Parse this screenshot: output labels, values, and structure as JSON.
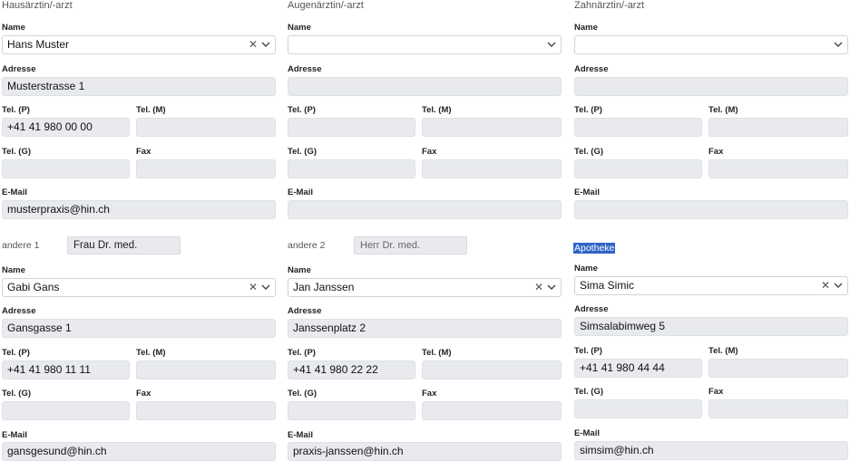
{
  "labels": {
    "name": "Name",
    "address": "Adresse",
    "tel_p": "Tel. (P)",
    "tel_m": "Tel. (M)",
    "tel_g": "Tel. (G)",
    "fax": "Fax",
    "email": "E-Mail"
  },
  "hausarzt": {
    "title": "Hausärztin/-arzt",
    "name": "Hans Muster",
    "address": "Musterstrasse 1",
    "tel_p": "+41 41 980 00 00",
    "tel_m": "",
    "tel_g": "",
    "fax": "",
    "email": "musterpraxis@hin.ch"
  },
  "augenarzt": {
    "title": "Augenärztin/-arzt",
    "name": "",
    "address": "",
    "tel_p": "",
    "tel_m": "",
    "tel_g": "",
    "fax": "",
    "email": ""
  },
  "zahnarzt": {
    "title": "Zahnärztin/-arzt",
    "name": "",
    "address": "",
    "tel_p": "",
    "tel_m": "",
    "tel_g": "",
    "fax": "",
    "email": ""
  },
  "andere1": {
    "title": "andere 1",
    "salutation": "Frau Dr. med.",
    "name": "Gabi Gans",
    "address": "Gansgasse 1",
    "tel_p": "+41 41 980 11 11",
    "tel_m": "",
    "tel_g": "",
    "fax": "",
    "email": "gansgesund@hin.ch"
  },
  "andere2": {
    "title": "andere 2",
    "salutation_placeholder": "Herr Dr. med.",
    "name": "Jan Janssen",
    "address": "Janssenplatz 2",
    "tel_p": "+41 41 980 22 22",
    "tel_m": "",
    "tel_g": "",
    "fax": "",
    "email": "praxis-janssen@hin.ch"
  },
  "apotheke": {
    "title": "Apotheke",
    "name": "Sima Simic",
    "address": "Simsalabimweg 5",
    "tel_p": "+41 41 980 44 44",
    "tel_m": "",
    "tel_g": "",
    "fax": "",
    "email": "simsim@hin.ch"
  },
  "icons": {
    "clear": "clear-icon",
    "dropdown": "chevron-down-icon"
  }
}
